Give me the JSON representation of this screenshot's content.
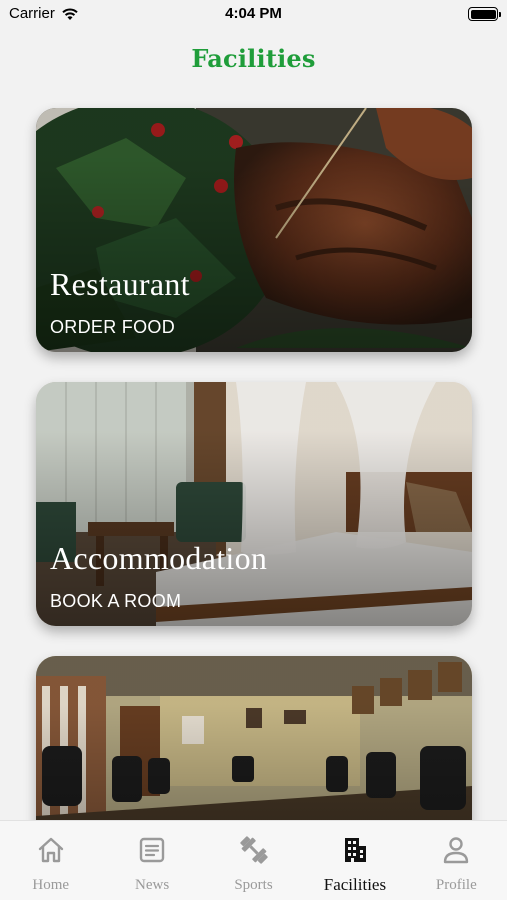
{
  "status_bar": {
    "carrier": "Carrier",
    "time": "4:04 PM"
  },
  "header": {
    "title": "Facilities"
  },
  "cards": [
    {
      "title": "Restaurant",
      "subtitle": "ORDER FOOD"
    },
    {
      "title": "Accommodation",
      "subtitle": "BOOK A ROOM"
    },
    {
      "title": "",
      "subtitle": ""
    }
  ],
  "tabs": [
    {
      "label": "Home",
      "icon": "home-icon"
    },
    {
      "label": "News",
      "icon": "news-icon"
    },
    {
      "label": "Sports",
      "icon": "dumbbell-icon"
    },
    {
      "label": "Facilities",
      "icon": "building-icon",
      "active": true
    },
    {
      "label": "Profile",
      "icon": "person-icon"
    }
  ],
  "colors": {
    "accent": "#1f9d3a",
    "inactive": "#9a9a9a",
    "active": "#111111"
  }
}
